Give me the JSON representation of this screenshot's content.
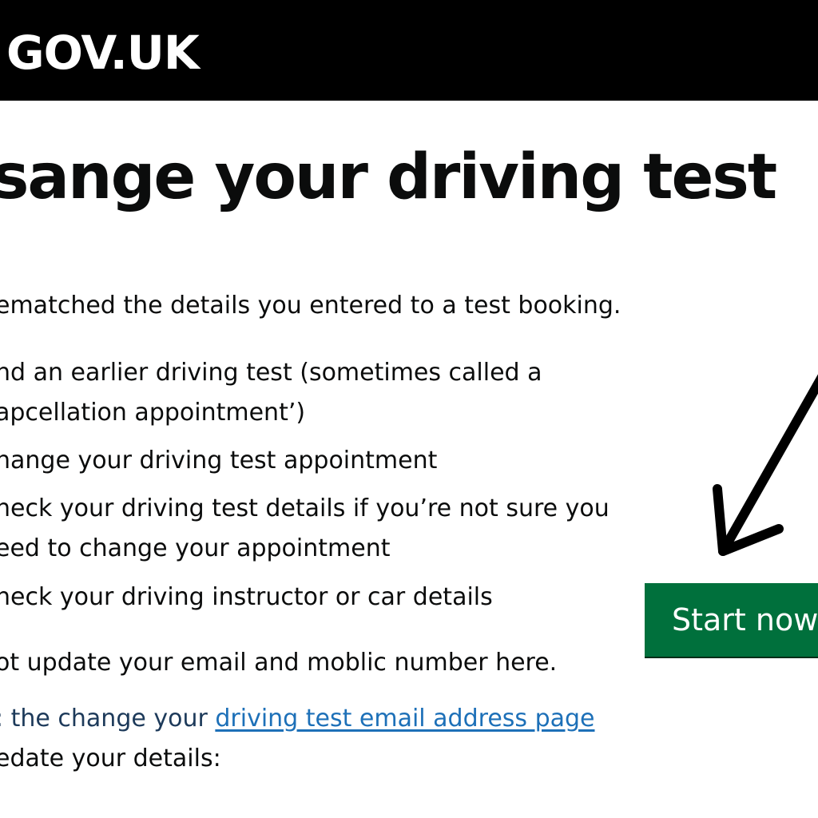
{
  "header": {
    "logo_text": "GOV.UK"
  },
  "main": {
    "title": "sange your driving test",
    "intro": "ematched the details you entered to a test booking.",
    "list": [
      "nd an earlier driving test (sometimes called a",
      "apcellation appointment’)",
      "hange your driving test appointment",
      "neck your driving test details if you’re not sure you",
      "eed to change your appointment",
      "neck your driving instructor or   car details"
    ],
    "note": "ot update your email and moblic number here.",
    "email_prefix": ": the change your ",
    "email_link": "driving test email address page",
    "email_suffix": "edate your details:"
  },
  "start_button": {
    "label": "Start now"
  },
  "annotation": {
    "icon": "arrow-icon",
    "color": "#000000"
  }
}
